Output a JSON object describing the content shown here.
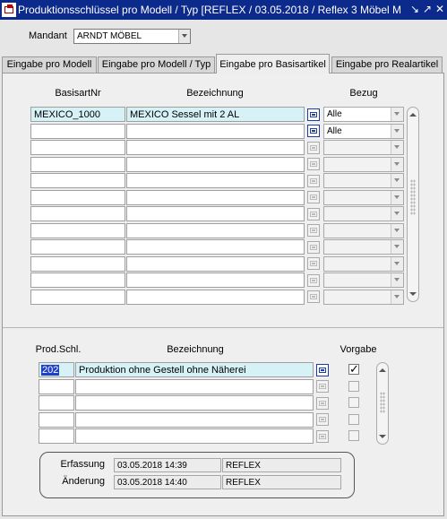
{
  "window": {
    "title": "Produktionsschlüssel pro Modell / Typ  [REFLEX / 03.05.2018 / Reflex 3 Möbel M",
    "minimize_glyph": "↘",
    "maximize_glyph": "↗",
    "close_glyph": "✕"
  },
  "mandant": {
    "label": "Mandant",
    "value": "ARNDT MÖBEL"
  },
  "tabs": [
    {
      "label": "Eingabe pro Modell"
    },
    {
      "label": "Eingabe pro Modell / Typ"
    },
    {
      "label": "Eingabe pro Basisartikel"
    },
    {
      "label": "Eingabe pro Realartikel"
    }
  ],
  "basis_grid": {
    "headers": {
      "basisartnr": "BasisartNr",
      "bezeichnung": "Bezeichnung",
      "bezug": "Bezug"
    },
    "rows": [
      {
        "basisartnr": "MEXICO_1000",
        "bezeichnung": "MEXICO Sessel mit 2 AL",
        "bezug": "Alle"
      },
      {
        "basisartnr": "",
        "bezeichnung": "",
        "bezug": "Alle"
      },
      {
        "basisartnr": "",
        "bezeichnung": "",
        "bezug": ""
      },
      {
        "basisartnr": "",
        "bezeichnung": "",
        "bezug": ""
      },
      {
        "basisartnr": "",
        "bezeichnung": "",
        "bezug": ""
      },
      {
        "basisartnr": "",
        "bezeichnung": "",
        "bezug": ""
      },
      {
        "basisartnr": "",
        "bezeichnung": "",
        "bezug": ""
      },
      {
        "basisartnr": "",
        "bezeichnung": "",
        "bezug": ""
      },
      {
        "basisartnr": "",
        "bezeichnung": "",
        "bezug": ""
      },
      {
        "basisartnr": "",
        "bezeichnung": "",
        "bezug": ""
      },
      {
        "basisartnr": "",
        "bezeichnung": "",
        "bezug": ""
      },
      {
        "basisartnr": "",
        "bezeichnung": "",
        "bezug": ""
      }
    ]
  },
  "prod_grid": {
    "headers": {
      "prodschl": "Prod.Schl.",
      "bezeichnung": "Bezeichnung",
      "vorgabe": "Vorgabe"
    },
    "rows": [
      {
        "prodschl": "202",
        "bezeichnung": "Produktion ohne Gestell ohne Näherei",
        "vorgabe": true
      },
      {
        "prodschl": "",
        "bezeichnung": "",
        "vorgabe": false
      },
      {
        "prodschl": "",
        "bezeichnung": "",
        "vorgabe": false
      },
      {
        "prodschl": "",
        "bezeichnung": "",
        "vorgabe": false
      },
      {
        "prodschl": "",
        "bezeichnung": "",
        "vorgabe": false
      }
    ]
  },
  "audit": {
    "erfassung_label": "Erfassung",
    "erfassung_date": "03.05.2018 14:39",
    "erfassung_user": "REFLEX",
    "aenderung_label": "Änderung",
    "aenderung_date": "03.05.2018 14:40",
    "aenderung_user": "REFLEX"
  },
  "colors": {
    "titlebar": "#0b2a8c",
    "highlight": "#d6f2f6",
    "selection": "#2040c8"
  },
  "icons": {
    "app": "app-icon",
    "lov": "list-of-values-icon",
    "check": "checkmark-icon"
  }
}
